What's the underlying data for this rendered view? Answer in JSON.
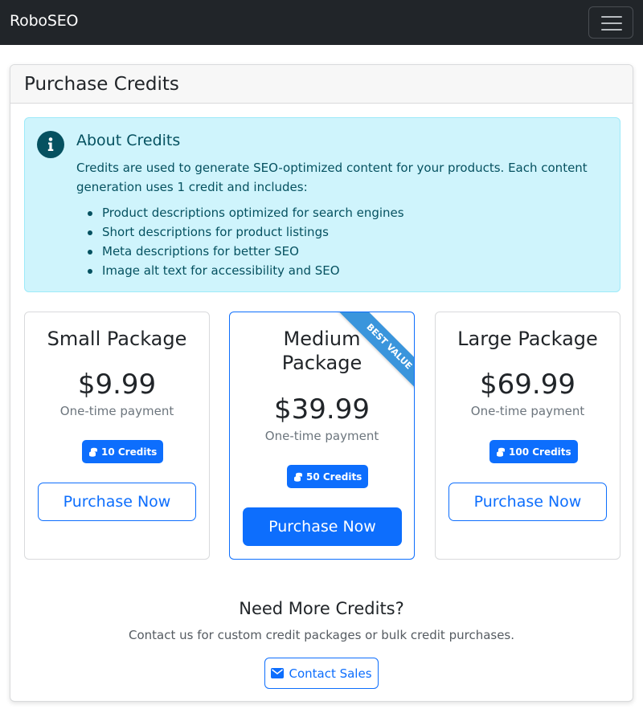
{
  "navbar": {
    "brand": "RoboSEO",
    "menu_icon": "hamburger-menu-icon"
  },
  "page": {
    "title": "Purchase Credits"
  },
  "about": {
    "icon": "info-icon",
    "heading": "About Credits",
    "text": "Credits are used to generate SEO-optimized content for your products. Each content generation uses 1 credit and includes:",
    "items": [
      "Product descriptions optimized for search engines",
      "Short descriptions for product listings",
      "Meta descriptions for better SEO",
      "Image alt text for accessibility and SEO"
    ]
  },
  "packages": [
    {
      "name": "Small Package",
      "price": "$9.99",
      "note": "One-time payment",
      "credits": "10 Credits",
      "button": "Purchase Now"
    },
    {
      "name_line1": "Medium",
      "name_line2": "Package",
      "price": "$39.99",
      "note": "One-time payment",
      "credits": "50 Credits",
      "button": "Purchase Now",
      "ribbon": "BEST VALUE"
    },
    {
      "name": "Large Package",
      "price": "$69.99",
      "note": "One-time payment",
      "credits": "100 Credits",
      "button": "Purchase Now"
    }
  ],
  "more": {
    "title": "Need More Credits?",
    "text": "Contact us for custom credit packages or bulk credit purchases.",
    "button": "Contact Sales",
    "button_icon": "envelope-icon"
  },
  "colors": {
    "primary": "#0d6efd",
    "navbar": "#212529",
    "info_bg": "#cff4fc",
    "info_text": "#055160",
    "ribbon": "#3a95dc"
  }
}
